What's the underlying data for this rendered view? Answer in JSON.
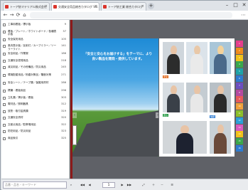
{
  "tabs": [
    {
      "title": "トーア紡マテリアル株式会社",
      "active": false
    },
    {
      "title": "交通安全用品総合カタログ Vol.",
      "active": true
    },
    {
      "title": "トーア紡工業 総合カタログ",
      "active": false
    }
  ],
  "sidebar": {
    "items": [
      {
        "label": "工事用看板／標示板",
        "page": "9"
      },
      {
        "label": "看板／プレート／ホワイトボード／各種表示板",
        "page": "37"
      },
      {
        "label": "安全保安用品",
        "page": "105"
      },
      {
        "label": "風向表示板／反射灯／カーブミラー／ソーラーライト",
        "page": "141"
      },
      {
        "label": "安全用品／作業服",
        "page": "186"
      },
      {
        "label": "交通安全啓発用品",
        "page": "218"
      },
      {
        "label": "減災用品／その他備品／防災用品",
        "page": "245"
      },
      {
        "label": "環境配慮用品／粉塵対策品／騒音対策",
        "page": "271"
      },
      {
        "label": "安全シート／テープ類／保護用資材",
        "page": "286"
      },
      {
        "label": "標識・看板用品",
        "page": "296"
      },
      {
        "label": "立札類／掲示板／看板",
        "page": "303"
      },
      {
        "label": "電材品／照明器具",
        "page": "312"
      },
      {
        "label": "放熱・取付金具類",
        "page": "319"
      },
      {
        "label": "交通安全資材",
        "page": "320"
      },
      {
        "label": "交差点用品／駐車場用品",
        "page": "322"
      },
      {
        "label": "防犯用品／防災用品",
        "page": "323"
      },
      {
        "label": "商品索引",
        "page": "325"
      }
    ]
  },
  "spread": {
    "slogan": "「安全と安心をお届けする」をテーマに、より良い製品を開発・提供しています。",
    "prev_arrow": "‹",
    "next_arrow": "›"
  },
  "right_page": {
    "captions": [
      "安全",
      "安心",
      "信頼"
    ]
  },
  "color_tabs": [
    {
      "label": "1",
      "color": "#e63f8c"
    },
    {
      "label": "2",
      "color": "#f08b1a"
    },
    {
      "label": "3",
      "color": "#f2c21a"
    },
    {
      "label": "4",
      "color": "#3aa84b"
    },
    {
      "label": "5",
      "color": "#1ea3a8"
    },
    {
      "label": "6",
      "color": "#2d7bd0"
    },
    {
      "label": "7",
      "color": "#6d4fc0"
    },
    {
      "label": "8",
      "color": "#b54aa0"
    },
    {
      "label": "9",
      "color": "#e85a5a"
    },
    {
      "label": "10",
      "color": "#f0a03a"
    },
    {
      "label": "11",
      "color": "#8cbf2a"
    },
    {
      "label": "12",
      "color": "#2aa0d8"
    },
    {
      "label": "13",
      "color": "#d85ac0"
    },
    {
      "label": "14",
      "color": "#f2c21a"
    },
    {
      "label": "15",
      "color": "#3aa84b"
    },
    {
      "label": "16",
      "color": "#2d7bd0"
    }
  ],
  "toolbar": {
    "search_placeholder": "品番・品名・キーワード",
    "page_number": "1",
    "buttons": [
      "◀◀",
      "◀",
      "▶",
      "▶▶",
      "⤢",
      "＋",
      "－",
      "☰"
    ]
  }
}
